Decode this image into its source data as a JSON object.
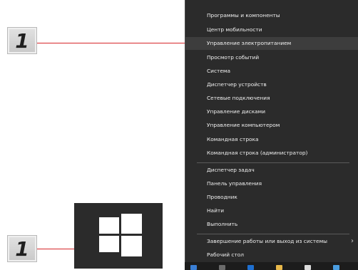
{
  "callouts": {
    "top_number": "1",
    "bottom_number": "1"
  },
  "colors": {
    "callout_accent": "#d6262a",
    "menu_background": "#2b2b2b",
    "menu_highlight": "#3d3d3d",
    "menu_text": "#f0f0f0"
  },
  "start_button": {
    "icon": "windows-logo-icon"
  },
  "menu": {
    "highlighted_index": 2,
    "group1": [
      "Программы и компоненты",
      "Центр мобильности",
      "Управление электропитанием",
      "Просмотр событий",
      "Система",
      "Диспетчер устройств",
      "Сетевые подключения",
      "Управление дисками",
      "Управление компьютером",
      "Командная строка",
      "Командная строка (администратор)"
    ],
    "group2": [
      "Диспетчер задач",
      "Панель управления",
      "Проводник",
      "Найти",
      "Выполнить"
    ],
    "group3": [
      "Завершение работы или выход из системы",
      "Рабочий стол"
    ],
    "submenu_arrow": "›"
  }
}
